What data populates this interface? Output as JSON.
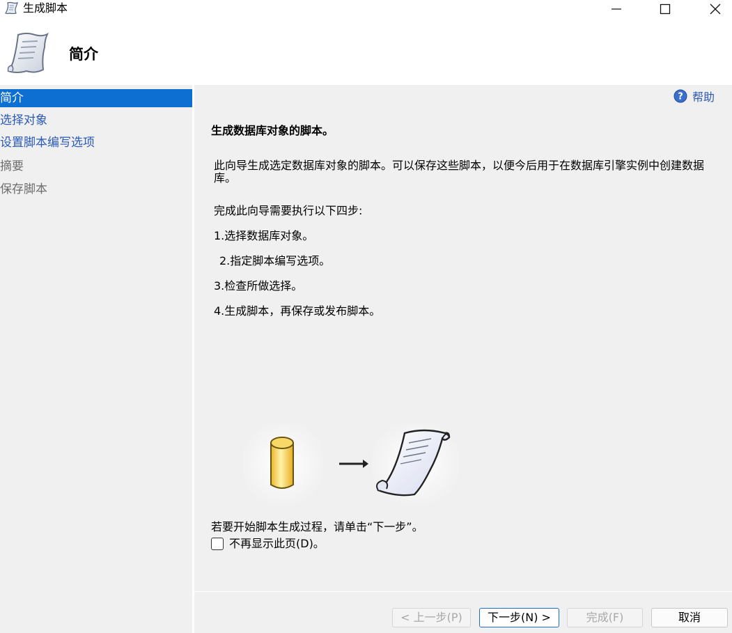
{
  "window": {
    "title": "生成脚本",
    "icons": [
      "scroll-icon",
      "minimize-icon",
      "maximize-icon",
      "close-icon"
    ]
  },
  "header": {
    "title": "简介",
    "icon": "scroll-icon"
  },
  "sidebar": {
    "items": [
      {
        "label": "简介",
        "state": "active"
      },
      {
        "label": "选择对象",
        "state": "link"
      },
      {
        "label": "设置脚本编写选项",
        "state": "link"
      },
      {
        "label": "摘要",
        "state": "disabled"
      },
      {
        "label": "保存脚本",
        "state": "disabled"
      }
    ]
  },
  "main": {
    "help_label": "帮助",
    "title": "生成数据库对象的脚本。",
    "description": "此向导生成选定数据库对象的脚本。可以保存这些脚本，以便今后用于在数据库引擎实例中创建数据库。",
    "steps_intro": "完成此向导需要执行以下四步:",
    "steps": [
      "1.选择数据库对象。",
      "2.指定脚本编写选项。",
      "3.检查所做选择。",
      "4.生成脚本，再保存或发布脚本。"
    ],
    "start_text": "若要开始脚本生成过程，请单击“下一步”。",
    "checkbox_label": "不再显示此页(D)。",
    "checkbox_checked": false
  },
  "buttons": {
    "prev": "< 上一步(P)",
    "next": "下一步(N) >",
    "finish": "完成(F)",
    "cancel": "取消"
  },
  "colors": {
    "selection": "#0d6fd1",
    "link": "#2a59b7",
    "panel_bg": "#f0f0f0"
  }
}
